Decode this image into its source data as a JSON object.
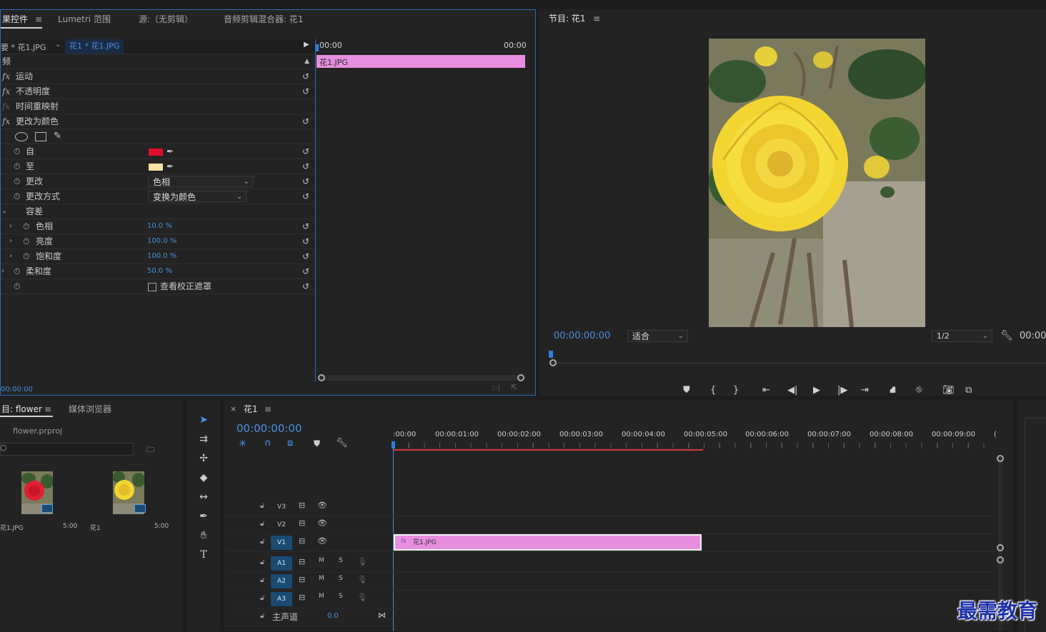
{
  "effect_controls": {
    "tabs": [
      "果控件",
      "Lumetri 范围",
      "源:（无剪辑）",
      "音频剪辑混合器: 花1"
    ],
    "menu_icon": "≡",
    "source_label": "要 * 花1.JPG",
    "clip_label": "花1 * 花1.JPG",
    "video_header": "频",
    "effects": [
      "运动",
      "不透明度",
      "时间重映射",
      "更改为颜色"
    ],
    "props": {
      "from": "自",
      "to": "至",
      "change": "更改",
      "change_by": "更改方式",
      "tolerance": "容差",
      "hue": "色相",
      "lightness": "亮度",
      "saturation": "饱和度",
      "softness": "柔和度"
    },
    "values": {
      "change_dd": "色相",
      "change_by_dd": "变换为颜色",
      "hue": "10.0 %",
      "lightness": "100.0 %",
      "saturation": "100.0 %",
      "softness": "50.0 %",
      "mask_checkbox": "查看校正遮罩"
    },
    "colors": {
      "from": "#e0102c",
      "to": "#f3e3a3",
      "clip": "#e88ee0"
    },
    "timeline": {
      "start": "00:00",
      "end": "00:00",
      "clip_name": "花1.JPG"
    },
    "timecode": "00:00:00"
  },
  "program": {
    "title": "节目: 花1",
    "timecode": "00:00:00:00",
    "fit": "适合",
    "resolution": "1/2",
    "timecode_right": "00:00"
  },
  "project": {
    "tabs": [
      "目: flower",
      "媒体浏览器"
    ],
    "file": "flower.prproj",
    "items": [
      {
        "name": "花1.JPG",
        "duration": "5:00"
      },
      {
        "name": "花1",
        "duration": "5:00"
      }
    ]
  },
  "timeline": {
    "close": "×",
    "tab": "花1",
    "timecode": "00:00:00:00",
    "ruler": [
      ":00:00",
      "00:00:01:00",
      "00:00:02:00",
      "00:00:03:00",
      "00:00:04:00",
      "00:00:05:00",
      "00:00:06:00",
      "00:00:07:00",
      "00:00:08:00",
      "00:00:09:00",
      "("
    ],
    "tracks": [
      "V3",
      "V2",
      "V1",
      "A1",
      "A2",
      "A3"
    ],
    "track_m": "M",
    "track_s": "S",
    "master": "主声道",
    "master_value": "0.0",
    "clip_fx": "fx",
    "clip_name": "花1.JPG"
  },
  "watermark": "最需教育"
}
